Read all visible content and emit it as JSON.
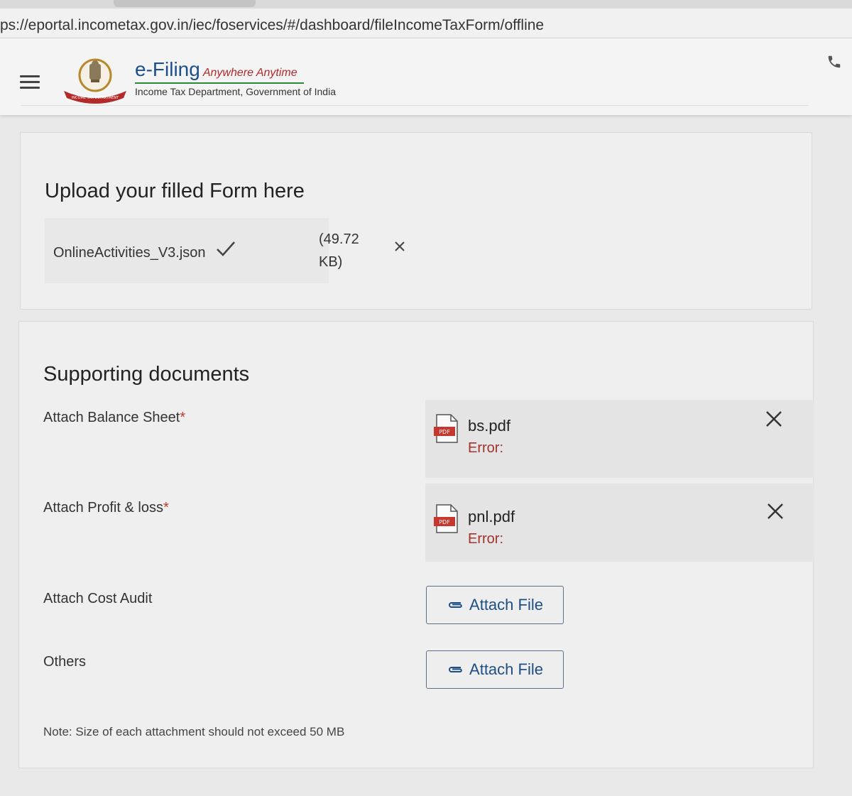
{
  "browser": {
    "url": "ps://eportal.incometax.gov.in/iec/foservices/#/dashboard/fileIncomeTaxForm/offline"
  },
  "header": {
    "brand_title": "e-Filing",
    "brand_tagline": "Anywhere Anytime",
    "brand_subtitle": "Income Tax Department, Government of India",
    "emblem_text": "INCOME TAX DEPARTMENT"
  },
  "upload_section": {
    "title": "Upload your filled Form here",
    "file_name": "OnlineActivities_V3.json",
    "file_size_line1": "(49.72",
    "file_size_line2": "KB)"
  },
  "supporting": {
    "title": "Supporting documents",
    "rows": [
      {
        "label": "Attach Balance Sheet",
        "required": "*",
        "file": "bs.pdf",
        "error": "Error:",
        "pdf_badge": "PDF"
      },
      {
        "label": "Attach Profit & loss",
        "required": "*",
        "file": "pnl.pdf",
        "error": "Error:",
        "pdf_badge": "PDF"
      },
      {
        "label": "Attach Cost Audit",
        "button": "Attach File"
      },
      {
        "label": "Others",
        "button": "Attach File"
      }
    ],
    "note": "Note: Size of each attachment should not exceed 50 MB"
  },
  "colors": {
    "brand_blue": "#1d4f8a",
    "tagline_red": "#b22a2a",
    "error_red": "#a3322a",
    "button_text": "#1f4e85",
    "pdf_red": "#c8372d"
  }
}
